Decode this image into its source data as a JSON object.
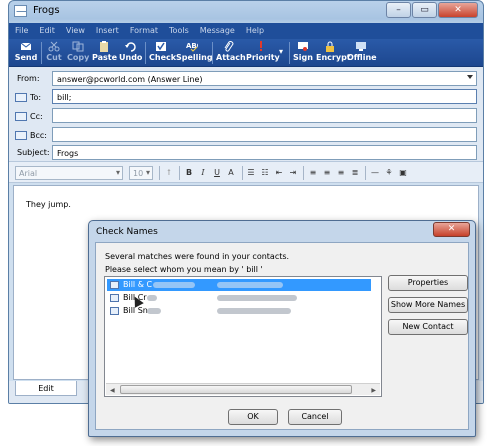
{
  "window": {
    "title": "Frogs",
    "controls": [
      "–",
      "▭",
      "✕"
    ]
  },
  "menu": [
    "File",
    "Edit",
    "View",
    "Insert",
    "Format",
    "Tools",
    "Message",
    "Help"
  ],
  "toolbar": {
    "send": "Send",
    "cut": "Cut",
    "copy": "Copy",
    "paste": "Paste",
    "undo": "Undo",
    "check": "Check",
    "spelling": "Spelling",
    "attach": "Attach",
    "priority": "Priority",
    "sign": "Sign",
    "encrypt": "Encrypt",
    "offline": "Offline"
  },
  "headers": {
    "from_label": "From:",
    "from_value": "answer@pcworld.com    (Answer Line)",
    "to_label": "To:",
    "to_value": "bill;",
    "cc_label": "Cc:",
    "cc_value": "",
    "bcc_label": "Bcc:",
    "bcc_value": "",
    "subject_label": "Subject:",
    "subject_value": "Frogs"
  },
  "format": {
    "font": "Arial",
    "size": "10"
  },
  "body": {
    "text": "They jump."
  },
  "tabs": {
    "edit": "Edit"
  },
  "dialog": {
    "title": "Check Names",
    "message1": "Several matches were found in your contacts.",
    "message2": "Please select whom you mean by ' bill '",
    "rows": [
      "Bill & C",
      "Bill Cr",
      "Bill Sn"
    ],
    "properties": "Properties",
    "show_more": "Show More Names",
    "new_contact": "New Contact",
    "ok": "OK",
    "cancel": "Cancel"
  },
  "colors": {
    "menubar": "#1f4e9a",
    "toolbar": "#2a5aa8",
    "selection": "#3399ff",
    "close": "#c6402a"
  }
}
